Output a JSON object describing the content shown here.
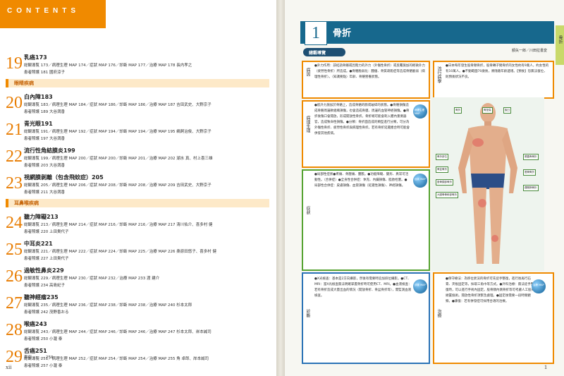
{
  "left_page": {
    "header": "CONTENTS",
    "folio": "xii",
    "entries": [
      {
        "num": "19",
        "title": "乳癌",
        "page": "173",
        "line1": "総観導覧 173／病理生理 MAP 174／症狀 MAP 176／診斷 MAP 177／治療 MAP 178 長内孝之",
        "line2": "患者照護 181 國府涼子"
      },
      {
        "num": "20",
        "title": "白內障",
        "page": "183",
        "line1": "総観導覧 183／病理生理 MAP 184／症狀 MAP 186／診斷 MAP 186／治療 MAP 187 吉田武史、大野京子",
        "line2": "患者照護 189 大谷満香"
      },
      {
        "num": "21",
        "title": "青光眼",
        "page": "191",
        "line1": "総観導覧 191／病理生理 MAP 192／症狀 MAP 194／診斷 MAP 194／治療 MAP 195 鵜飼治俊、大野京子",
        "line2": "患者照護 197 大谷満香"
      },
      {
        "num": "22",
        "title": "流行性角結膜炎",
        "page": "199",
        "line1": "総観導覧 199／病理生理 MAP 200／症狀 MAP 200／診斷 MAP 201／治療 MAP 202 湖水 真、村上喜三雄",
        "line2": "患者照護 203 大谷満香"
      },
      {
        "num": "23",
        "title": "視網膜剝離（包含飛蚊症）",
        "page": "205",
        "line1": "総観導覧 205／病理生理 MAP 206／症狀 MAP 208／診斷 MAP 208／治療 MAP 209 吉田武史、大野京子",
        "line2": "患者照護 211 大谷満香"
      },
      {
        "num": "24",
        "title": "聽力障礙",
        "page": "213",
        "line1": "総観導覧 213／病理生理 MAP 214／症狀 MAP 216／診斷 MAP 216／治療 MAP 217 清川佑介、喜多村 健",
        "line2": "患者照護 220 上田貴代子"
      },
      {
        "num": "25",
        "title": "中耳炎",
        "page": "221",
        "line1": "総観導覧 221／病理生理 MAP 222／症狀 MAP 224／診斷 MAP 225／治療 MAP 226 桑原田悠子、喜多村 健",
        "line2": "患者照護 227 上田貴代子"
      },
      {
        "num": "26",
        "title": "過敏性鼻炎",
        "page": "229",
        "line1": "総観導覧 229／病理生理 MAP 230／症狀 MAP 232／治療 MAP 233 渡 建介",
        "line2": "患者照護 234 高島紀子"
      },
      {
        "num": "27",
        "title": "聽神經瘤",
        "page": "235",
        "line1": "総観導覧 235／病理生理 MAP 236／症狀 MAP 238／診斷 MAP 238／治療 MAP 240 杉本太郎",
        "line2": "患者照護 242 茂野香おる"
      },
      {
        "num": "28",
        "title": "喉癌",
        "page": "243",
        "line1": "総観導覧 243／病理生理 MAP 244／症狀 MAP 246／診斷 MAP 246／治療 MAP 247 杉本太郎、岸本誠司",
        "line2": "患者照護 250 小瀧 泰"
      },
      {
        "num": "29",
        "title": "舌癌",
        "page": "251",
        "line1": "総観導覧 251／病理生理 MAP 252／症狀 MAP 254／診斷 MAP 254／治療 MAP 255 角 卓郎、岸本誠司",
        "line2": "患者照護 257 小瀧 泰"
      }
    ],
    "sections": [
      "眼睛疾病",
      "耳鼻喉疾病"
    ],
    "index": "索引 ……… 259"
  },
  "right_page": {
    "chapter_number": "1",
    "chapter_title": "骨折",
    "authors": "額矢一郎／川田拉書変",
    "side_tab": "骨折",
    "overview_pill": "總觀導覽",
    "folio": "1",
    "boxes": {
      "cause_label": "病因",
      "cause_text": "●外力作用：該結語骨骼或因階力的外力（外傷性骨折）或反覆施加的輕微外力（疲勞性骨折）所造成。●骨骼脆弱化：腫瘤、骨質疏鬆症等造成骨骼脆弱（病理性骨折）。（知識要點）年齡、骨骼營養狀態。",
      "epi_label": "流行病學",
      "epi_text": "●日本每年發生股骨頸骨折，股骨轉子間骨折的女性約有9萬人，約女性的有10萬人。●不動範圍70歲後，將隨著年齡遞增。【預後】恐無法復位，則預後狀況不良。",
      "patho_label": "病理生理",
      "patho_text": "●肌外力施加於骨骼上，造成骨骼的斷或破碎的狀態。●骨骼損傷造成骨骼周邊軟組織損傷，也會造成骨膜、周邊的血管神經損傷。●骨折後傷口會開放，形成開放性骨折。骨折端可能會刺入體內重要器官，造成致命性損傷。●分類：骨折面造成的類型進行分類，可分為外傷性骨折、疲勞性骨折與病理性骨折。若有骨折延遲癒合時可能會併發其他疾病。",
      "sym_label": "症狀",
      "sym_text": "●局部性症狀●疼痛、骨壓痛、腫脹。●功能障礙、變形、異常可活動性。（合併症）●全身性合併症：休克、內臟損傷、脂肪栓塞。●局部性合併症：皮膚損傷、血管損傷（延遲性損傷）、神經損傷。",
      "diag_label": "診斷",
      "diag_text": "●X光檢查：基本是2方向攝影，然後有需要時追加斜位攝影。●CT、MRI：當X光檢查無法明確掌握骨折時可使用CT、MRI。●血液檢查：若有骨折造成大量出血的情況（開放骨折、骨盆骨折等），需監測血液檢查。",
      "treat_label": "治療",
      "treat_text": "●保守療法：為移位狀況的骨折可先徒手整復，進行後再行石膏、夾板固定等，採取三角巾等方式。●外科治療：無法徒手整復時，可以進行手術內固定。股骨頸內側骨折等可考慮人工股骨頭置換術。開放性骨折須緊急處理。●固定後需要一段時間觀察。●康復：若有併發症可採用合適的治療。"
    },
    "map_orbs": [
      "病理生理 MAP",
      "症狀 MAP",
      "診斷 MAP",
      "治療 MAP"
    ],
    "figure_labels": [
      "骨折",
      "骨挫傷",
      "脫臼",
      "骨折部位",
      "骨盆骨折",
      "股骨頸部骨折",
      "大腿骨骨幹部骨折",
      "膝蓋骨骨折",
      "脛骨骨折",
      "踝關節骨折"
    ]
  }
}
